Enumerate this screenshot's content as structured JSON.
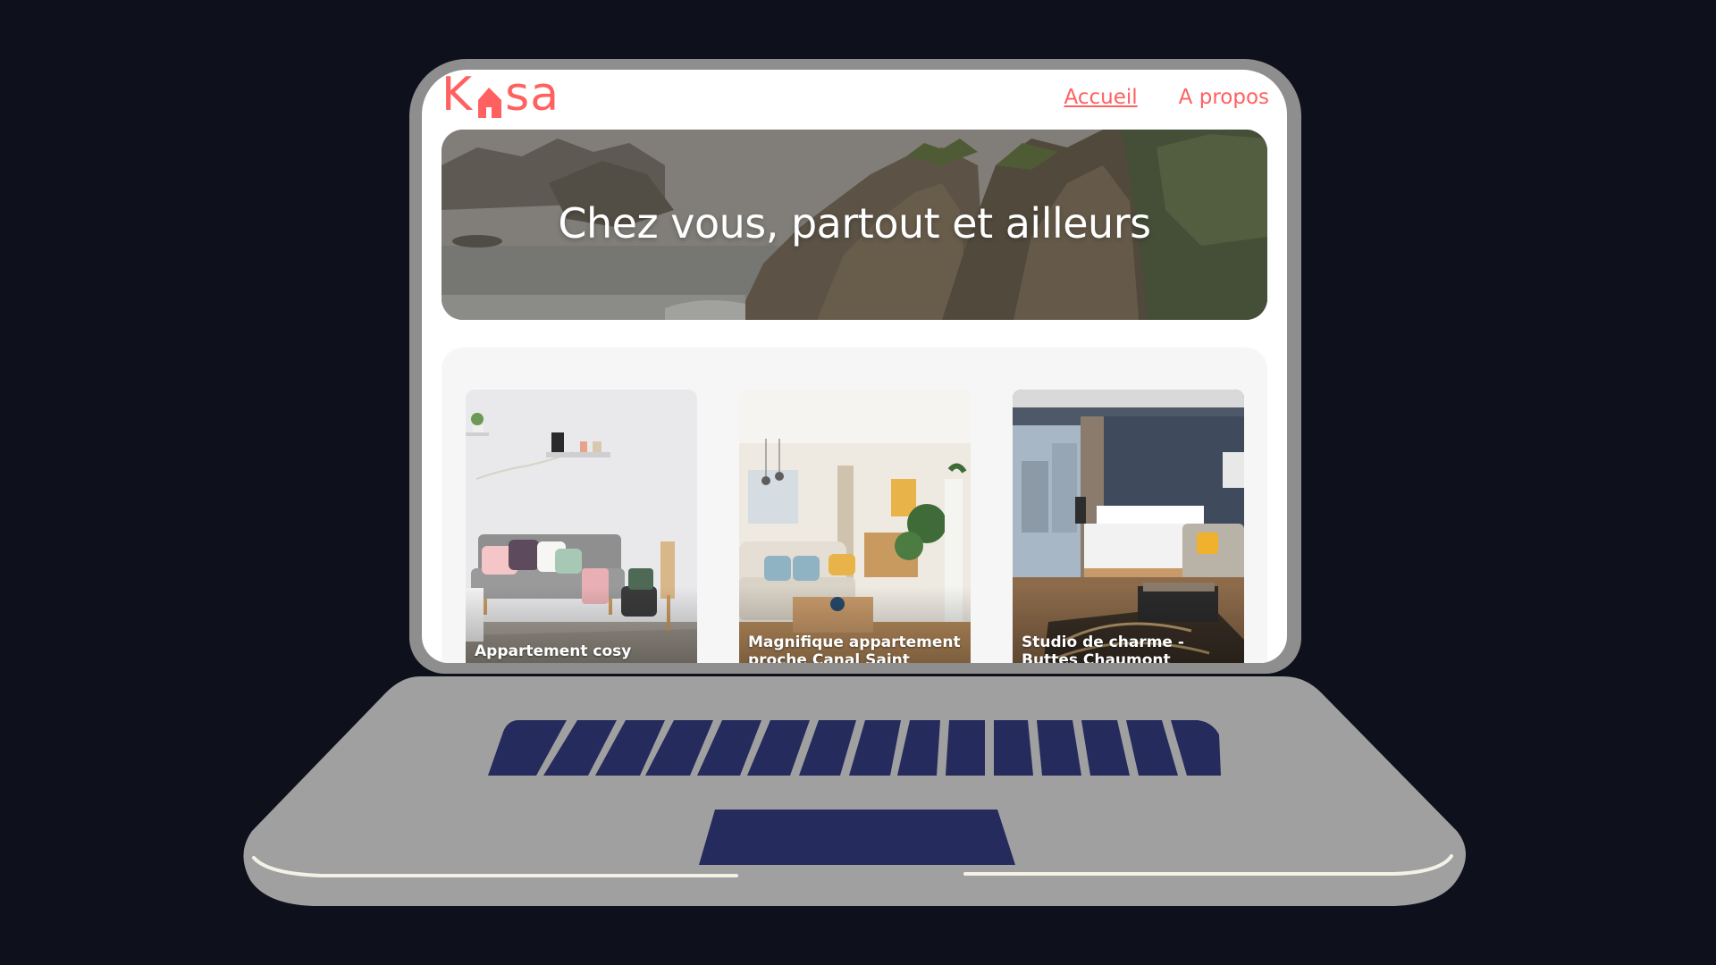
{
  "header": {
    "logo_text": {
      "k": "K",
      "rest": "sa"
    },
    "nav": [
      {
        "label": "Accueil",
        "active": true
      },
      {
        "label": "A propos",
        "active": false
      }
    ]
  },
  "banner": {
    "title": "Chez vous, partout et ailleurs"
  },
  "gallery": {
    "cards": [
      {
        "title": "Appartement cosy"
      },
      {
        "title": "Magnifique appartement proche Canal Saint Martin"
      },
      {
        "title": "Studio de charme - Buttes Chaumont"
      }
    ]
  },
  "colors": {
    "brand": "#ff6060",
    "background": "#0e111b",
    "laptop_body": "#8e8e8e",
    "keyboard_keys": "#252b5c",
    "gallery_bg": "#f6f6f6"
  }
}
